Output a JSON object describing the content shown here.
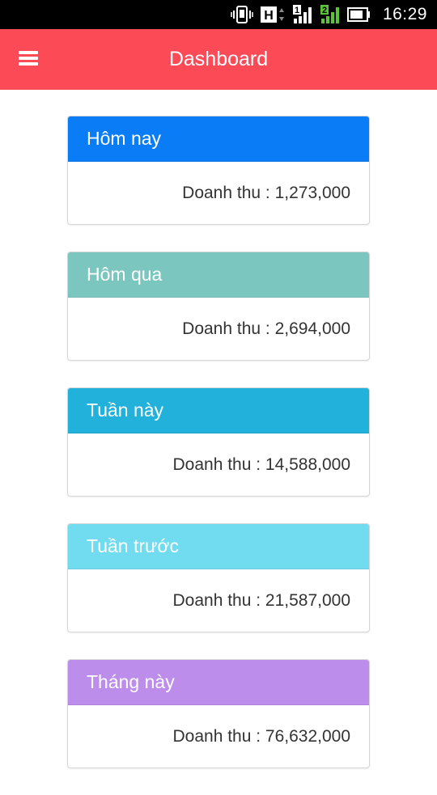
{
  "status_bar": {
    "time": "16:29",
    "icons": [
      "vibrate-icon",
      "hspa-signal-icon",
      "sim1-signal-icon",
      "sim2-signal-icon",
      "battery-icon"
    ],
    "sim1_label": "1",
    "sim2_label": "2",
    "network_label": "H"
  },
  "app_bar": {
    "title": "Dashboard",
    "menu_icon": "hamburger-menu-icon",
    "color": "#fc4a57"
  },
  "cards": [
    {
      "title": "Hôm nay",
      "revenue_text": "Doanh thu : 1,273,000",
      "color": "#0a7cf5"
    },
    {
      "title": "Hôm qua",
      "revenue_text": "Doanh thu : 2,694,000",
      "color": "#7cc6c0"
    },
    {
      "title": "Tuần này",
      "revenue_text": "Doanh thu : 14,588,000",
      "color": "#21b1db"
    },
    {
      "title": "Tuần trước",
      "revenue_text": "Doanh thu : 21,587,000",
      "color": "#71dbef"
    },
    {
      "title": "Tháng này",
      "revenue_text": "Doanh thu : 76,632,000",
      "color": "#bc8deb"
    }
  ]
}
